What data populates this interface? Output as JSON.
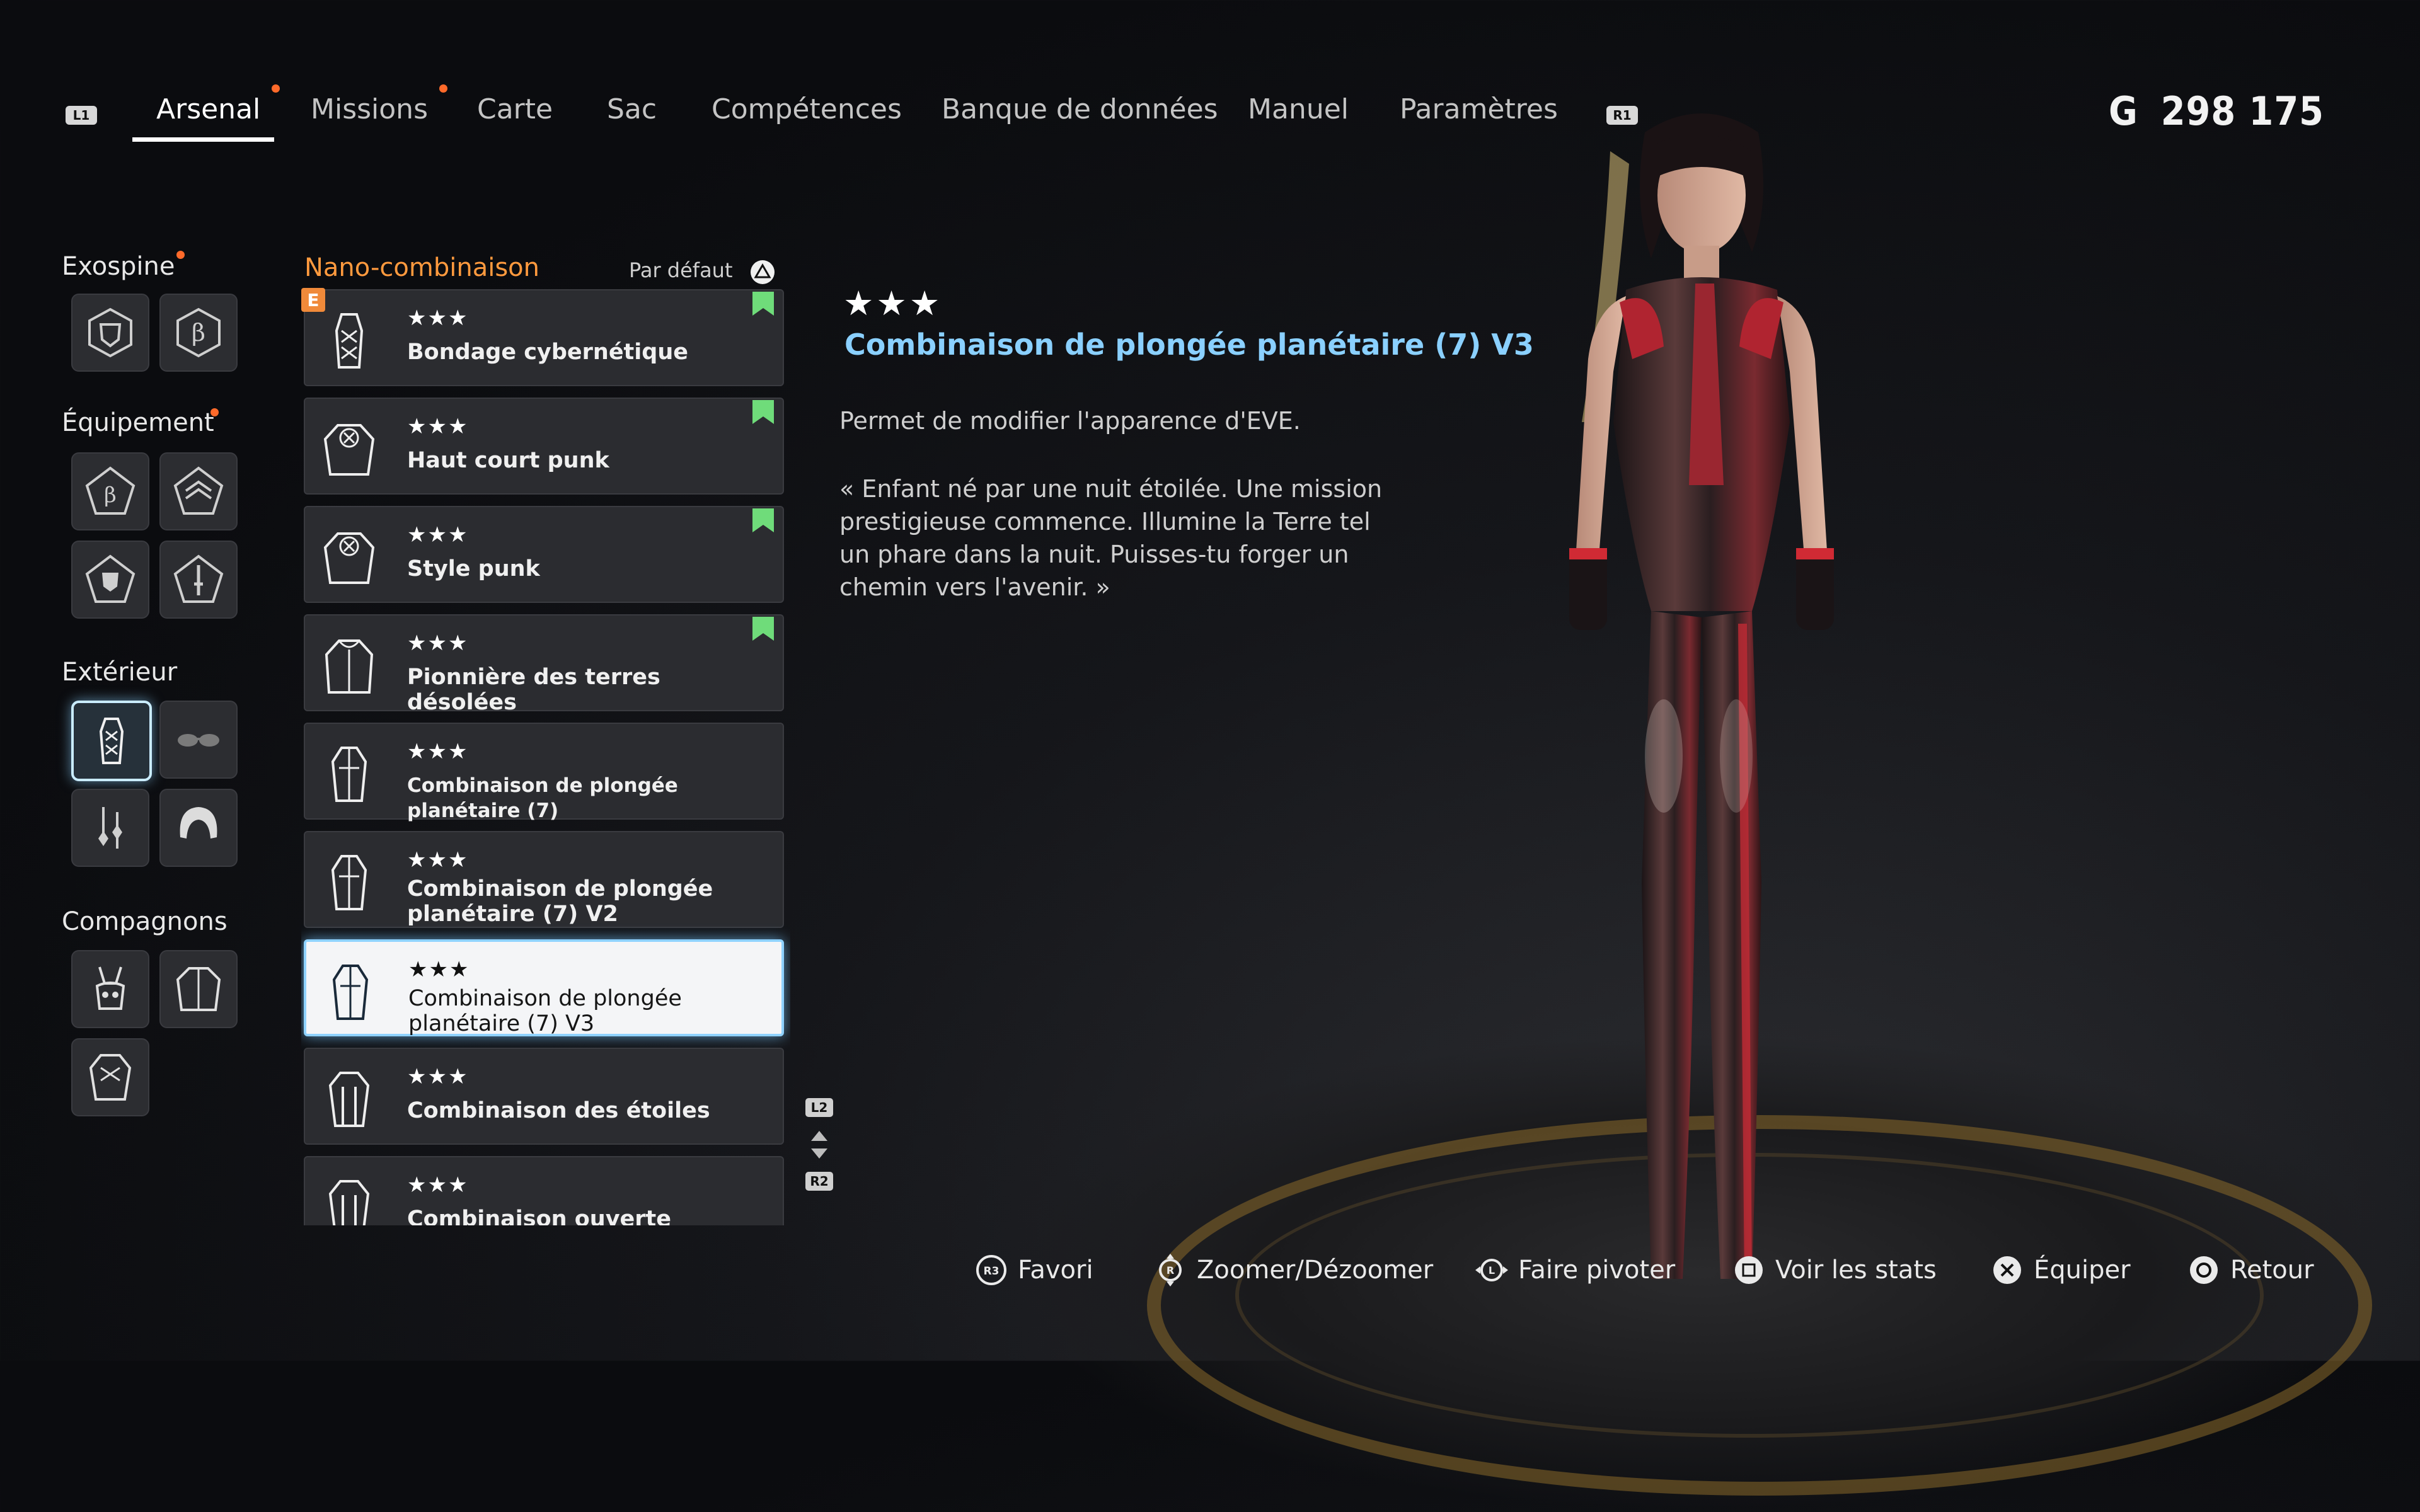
{
  "nav": {
    "left_button": "L1",
    "right_button": "R1",
    "tabs": [
      {
        "label": "Arsenal",
        "active": true,
        "notification": true
      },
      {
        "label": "Missions",
        "active": false,
        "notification": true
      },
      {
        "label": "Carte",
        "active": false,
        "notification": false
      },
      {
        "label": "Sac",
        "active": false,
        "notification": false
      },
      {
        "label": "Compétences",
        "active": false,
        "notification": false
      },
      {
        "label": "Banque de données",
        "active": false,
        "notification": false
      },
      {
        "label": "Manuel",
        "active": false,
        "notification": false
      },
      {
        "label": "Paramètres",
        "active": false,
        "notification": false
      }
    ]
  },
  "currency": {
    "symbol": "G",
    "amount": "298 175"
  },
  "sidebar": {
    "categories": [
      {
        "label": "Exospine",
        "notification": true,
        "slots": [
          "exospine-shield-icon",
          "exospine-beta-icon"
        ]
      },
      {
        "label": "Équipement",
        "notification": true,
        "slots": [
          "gear-beta-icon",
          "gear-chevron-icon",
          "gear-shield-icon",
          "gear-blade-icon"
        ]
      },
      {
        "label": "Extérieur",
        "notification": false,
        "slots": [
          "nanosuit-icon",
          "glasses-icon",
          "earrings-icon",
          "hair-icon"
        ],
        "selected_index": 0
      },
      {
        "label": "Compagnons",
        "notification": false,
        "slots": [
          "drone-icon",
          "companion-jacket-icon",
          "companion-suit-icon"
        ]
      }
    ]
  },
  "list": {
    "title": "Nano-combinaison",
    "sort_label": "Par défaut",
    "equipped_badge": "E",
    "scroll_up": "L2",
    "scroll_down": "R2",
    "items": [
      {
        "stars": "★★★",
        "name": "Bondage cybernétique",
        "bookmarked": true,
        "selected": false,
        "icon": "bodysuit-icon"
      },
      {
        "stars": "★★★",
        "name": "Haut court punk",
        "bookmarked": true,
        "selected": false,
        "icon": "jacket-icon"
      },
      {
        "stars": "★★★",
        "name": "Style punk",
        "bookmarked": true,
        "selected": false,
        "icon": "jacket-icon"
      },
      {
        "stars": "★★★",
        "name": "Pionnière des terres désolées",
        "bookmarked": true,
        "selected": false,
        "icon": "coat-icon"
      },
      {
        "stars": "★★★",
        "name": "Combinaison de plongée planétaire (7)",
        "bookmarked": false,
        "selected": false,
        "icon": "divesuit-icon"
      },
      {
        "stars": "★★★",
        "name": "Combinaison de plongée planétaire (7) V2",
        "bookmarked": false,
        "selected": false,
        "icon": "divesuit-icon"
      },
      {
        "stars": "★★★",
        "name": "Combinaison de plongée planétaire (7) V3",
        "bookmarked": false,
        "selected": true,
        "icon": "divesuit-icon"
      },
      {
        "stars": "★★★",
        "name": "Combinaison des étoiles",
        "bookmarked": false,
        "selected": false,
        "icon": "starsuit-icon"
      },
      {
        "stars": "★★★",
        "name": "Combinaison ouverte",
        "bookmarked": false,
        "selected": false,
        "icon": "starsuit-icon"
      }
    ]
  },
  "detail": {
    "stars": "★★★",
    "title": "Combinaison de plongée planétaire (7) V3",
    "description": "Permet de modifier l'apparence d'EVE.",
    "quote": "« Enfant né par une nuit étoilée. Une mission prestigieuse commence. Illumine la Terre tel un phare dans la nuit. Puisses-tu forger un chemin vers l'avenir. »"
  },
  "footer": {
    "prompts": [
      {
        "button": "R3",
        "label": "Favori"
      },
      {
        "button": "R",
        "label": "Zoomer/Dézoomer"
      },
      {
        "button": "L",
        "label": "Faire pivoter"
      },
      {
        "button": "square",
        "label": "Voir les stats"
      },
      {
        "button": "cross",
        "label": "Équiper"
      },
      {
        "button": "circle",
        "label": "Retour"
      }
    ]
  },
  "colors": {
    "accent_orange": "#ff9a3e",
    "title_blue": "#8ad0ff",
    "notification": "#ff6a2a",
    "bookmark_green": "#6fdc7a",
    "selected_glow": "#8fd2ff"
  }
}
